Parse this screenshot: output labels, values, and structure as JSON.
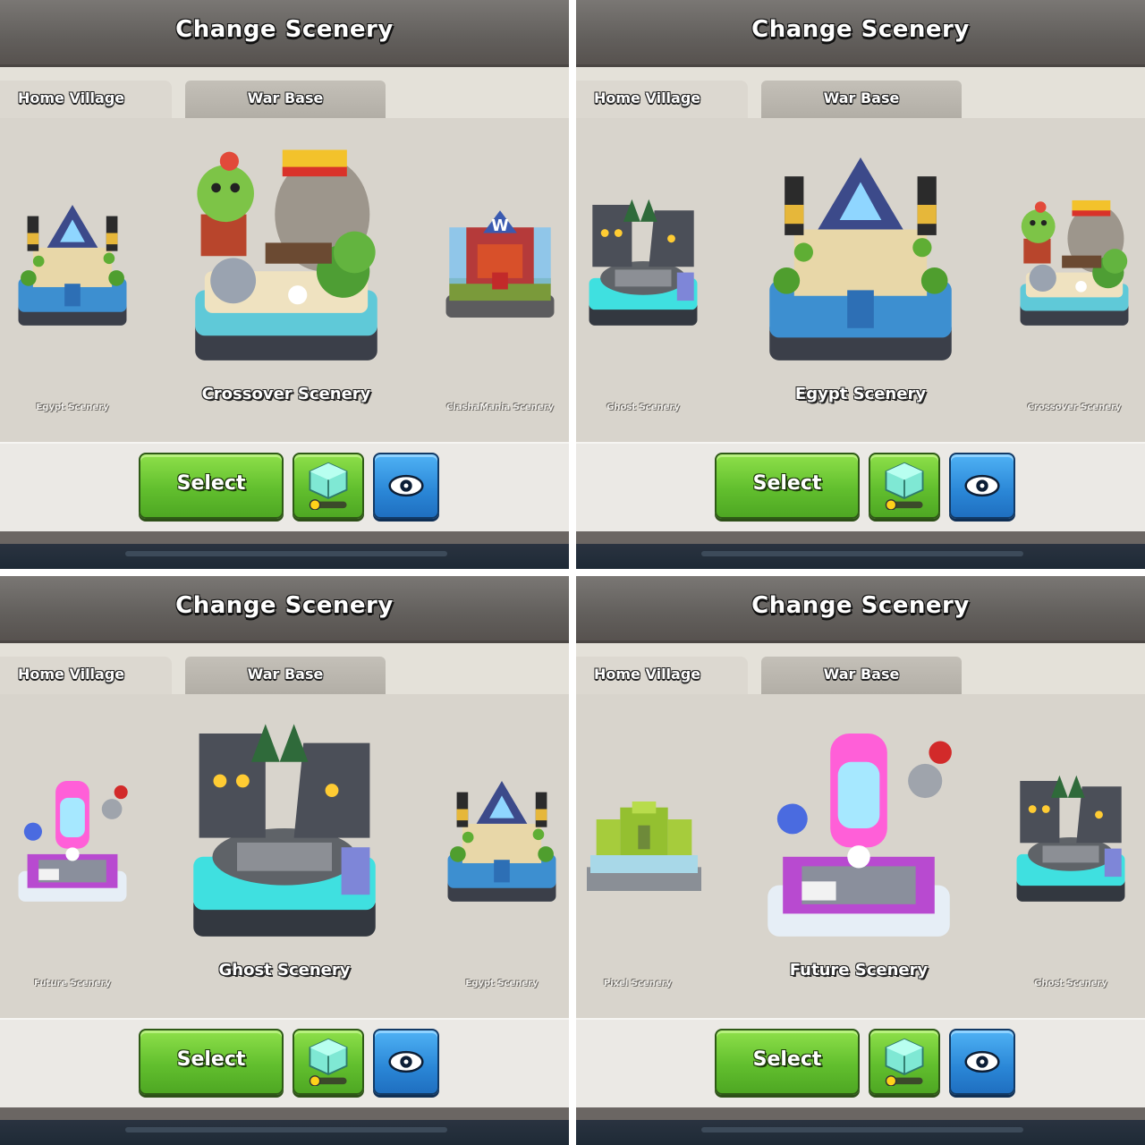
{
  "panels": [
    {
      "title": "Change Scenery",
      "tabs": {
        "home": "Home Village",
        "war": "War Base"
      },
      "left_scenery": "Egypt Scenery",
      "center_scenery": "Crossover Scenery",
      "right_scenery": "ClashaMania Scenery",
      "select_label": "Select"
    },
    {
      "title": "Change Scenery",
      "tabs": {
        "home": "Home Village",
        "war": "War Base"
      },
      "left_scenery": "Ghost Scenery",
      "center_scenery": "Egypt Scenery",
      "right_scenery": "Crossover Scenery",
      "select_label": "Select"
    },
    {
      "title": "Change Scenery",
      "tabs": {
        "home": "Home Village",
        "war": "War Base"
      },
      "left_scenery": "Future Scenery",
      "center_scenery": "Ghost Scenery",
      "right_scenery": "Egypt Scenery",
      "select_label": "Select"
    },
    {
      "title": "Change Scenery",
      "tabs": {
        "home": "Home Village",
        "war": "War Base"
      },
      "left_scenery": "Pixel Scenery",
      "center_scenery": "Future Scenery",
      "right_scenery": "Ghost Scenery",
      "select_label": "Select"
    }
  ],
  "icons": {
    "shop_button": "gem-box-icon",
    "preview_button": "eye-icon"
  },
  "colors": {
    "select_green": "#62bf2e",
    "preview_blue": "#2a86d6",
    "title_bar": "#625f5c"
  }
}
